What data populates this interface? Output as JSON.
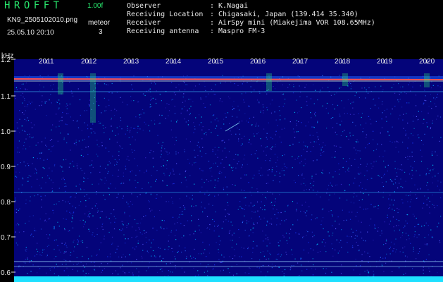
{
  "header": {
    "app_title": "HROFFT",
    "version": "1.00f",
    "filename": "KN9_2505102010.png",
    "datetime": "25.05.10 20:10",
    "mode_label": "meteor",
    "mode_value": "3"
  },
  "info": [
    {
      "label": "Observer",
      "value": ": K.Nagai"
    },
    {
      "label": "Receiving Location",
      "value": ": Chigasaki, Japan (139.414 35.340)"
    },
    {
      "label": "Receiver",
      "value": ": AirSpy mini (Miakejima VOR 108.65MHz)"
    },
    {
      "label": "Receiving antenna",
      "value": ": Maspro FM-3"
    }
  ],
  "axis": {
    "unit": "kHz",
    "y_ticks": [
      "1.2",
      "1.1",
      "1.0",
      "0.9",
      "0.8",
      "0.7",
      "0.6"
    ],
    "x_ticks": [
      "2011",
      "2012",
      "2013",
      "2014",
      "2015",
      "2016",
      "2017",
      "2018",
      "2019",
      "2020"
    ]
  },
  "colors": {
    "title": "#29e86e",
    "text": "#e8e8e8",
    "background": "#000000",
    "spectrum_base": "#00008b",
    "carrier": "#ff5050",
    "baseline": "#1ee0ff"
  }
}
